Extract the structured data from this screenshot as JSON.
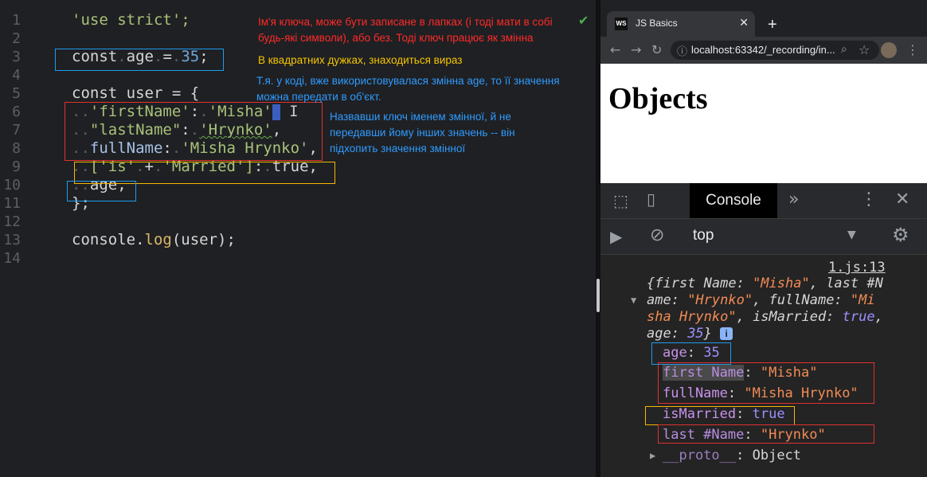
{
  "editor": {
    "line_numbers": [
      "1",
      "2",
      "3",
      "4",
      "5",
      "6",
      "7",
      "8",
      "9",
      "10",
      "11",
      "12",
      "13",
      "14"
    ],
    "lines": {
      "l1": "'use strict';",
      "l3_kw": "const",
      "l3_name": "age",
      "l3_eq": "=",
      "l3_val": "35",
      "l3_end": ";",
      "l5": "const user = {",
      "l6_key": "'firstName'",
      "l6_val": "'Misha'",
      "l7_key": "\"lastName\"",
      "l7_val": "'Hrynko'",
      "l8_key": "fullName",
      "l8_val": "'Misha Hrynko'",
      "l9_a": "['is'",
      "l9_plus": "+",
      "l9_b": "'Married']",
      "l9_val": "true,",
      "l10": "age,",
      "l11": "};",
      "l13_obj": "console",
      "l13_fn": "log",
      "l13_arg": "(user);"
    }
  },
  "notes": {
    "n1": "Ім'я ключа, може бути записане в лапках (і тоді мати в собі\nбудь-які символи), або без. Тоді ключ працює як змінна",
    "n2": "В квадратних дужках, знаходиться вираз",
    "n3": "Т.я. у коді, вже використовувалася змінна age, то її значення\nможна передати в об'єкт.",
    "n4": "Назвавши ключ іменем змінної, й не\nпередавши йому інших значень -- він\nпідхопить значення змінної"
  },
  "browser": {
    "tab_title": "JS Basics",
    "favicon_text": "WS",
    "url": "localhost:63342/_recording/in...",
    "page_heading": "Objects"
  },
  "devtools": {
    "console_tab": "Console",
    "context": "top",
    "source_link": "1.js:13",
    "summary": {
      "l1a": "{first Name: ",
      "l1b": "\"Misha\"",
      "l1c": ", last #N",
      "l2a": "ame: ",
      "l2b": "\"Hrynko\"",
      "l2c": ", fullName: ",
      "l2d": "\"Mi",
      "l3a": "sha Hrynko\"",
      "l3b": ", isMarried: ",
      "l3c": "true",
      "l3d": ",",
      "l4a": "age: ",
      "l4b": "35",
      "l4c": "}"
    },
    "props": [
      {
        "key": "age",
        "value": "35"
      },
      {
        "key": "first Name",
        "value": "\"Misha\""
      },
      {
        "key": "fullName",
        "value": "\"Misha Hrynko\""
      },
      {
        "key": "isMarried",
        "value": "true"
      },
      {
        "key": "last #Name",
        "value": "\"Hrynko\""
      },
      {
        "key": "__proto__",
        "value": "Object"
      }
    ]
  },
  "colors": {
    "red_box": "#e03131",
    "blue_box": "#1d9bf0",
    "yellow_box": "#f5b800",
    "note_red": "#ff2a2a",
    "note_yellow": "#f5c400",
    "note_blue": "#2f9bff"
  }
}
